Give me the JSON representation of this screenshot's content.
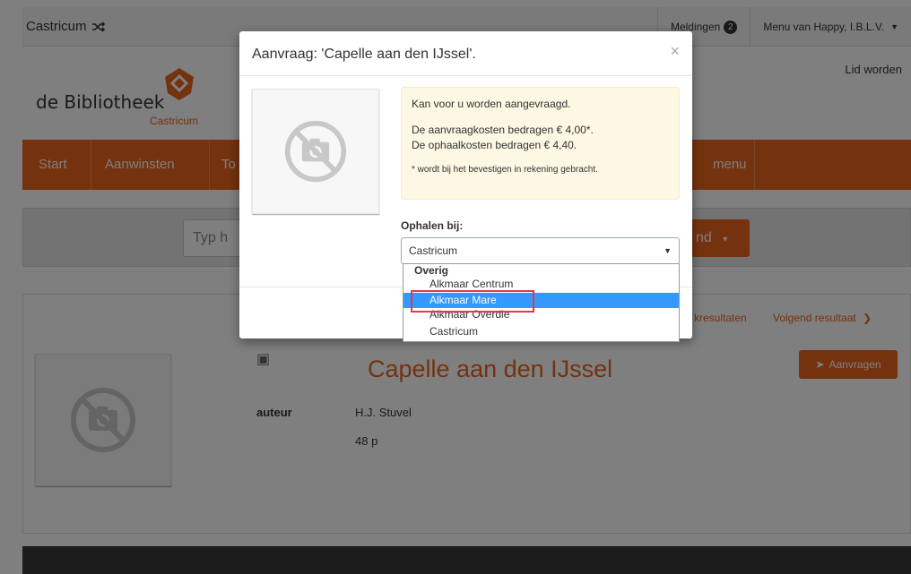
{
  "topbar": {
    "brand": "Castricum",
    "notifications_label": "Meldingen",
    "notifications_count": "2",
    "user_menu": "Menu van Happy, I.B.L.V.",
    "signup": "Lid worden"
  },
  "logo": {
    "title": "de Bibliotheek",
    "subtitle": "Castricum"
  },
  "nav": {
    "items": [
      "Start",
      "Aanwinsten",
      "To",
      "menu"
    ]
  },
  "search": {
    "placeholder": "Typ h",
    "button_label": "nd"
  },
  "pager": {
    "results_label": "kresultaten",
    "next_label": "Volgend resultaat"
  },
  "detail": {
    "title": "Capelle aan den IJssel",
    "request_button": "Aanvragen",
    "author_label": "auteur",
    "author_value": "H.J. Stuvel",
    "pages": "48 p"
  },
  "modal": {
    "title": "Aanvraag: 'Capelle aan den IJssel'.",
    "close": "×",
    "info_line1": "Kan voor u worden aangevraagd.",
    "info_line2": "De aanvraagkosten bedragen € 4,00*.",
    "info_line3": "De ophaalkosten bedragen € 4,40.",
    "info_note": "* wordt bij het bevestigen in rekening gebracht.",
    "pickup_label": "Ophalen bij:",
    "pickup_selected": "Castricum"
  },
  "dropdown": {
    "group": "Overig",
    "options": [
      "Alkmaar Centrum",
      "Alkmaar Mare",
      "Alkmaar Overdie",
      "Castricum"
    ],
    "selected_index": 1
  },
  "colors": {
    "accent": "#e8651e",
    "selection": "#3399ff",
    "highlight": "#e03a4a"
  }
}
